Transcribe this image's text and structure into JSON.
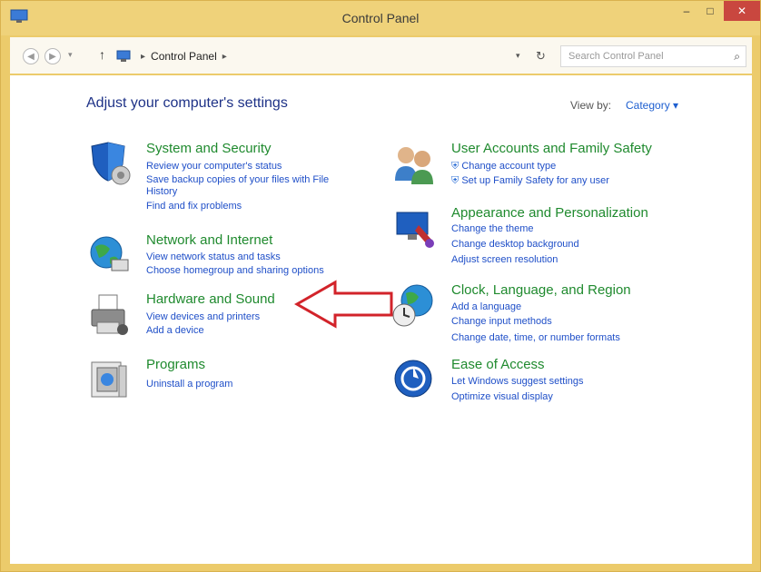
{
  "window": {
    "title": "Control Panel",
    "minimize": "–",
    "maximize": "□",
    "close": "✕"
  },
  "nav": {
    "back_icon": "back-arrow-icon",
    "forward_icon": "forward-arrow-icon",
    "up_icon": "up-arrow-icon",
    "breadcrumb": "Control Panel",
    "search_placeholder": "Search Control Panel"
  },
  "main": {
    "heading": "Adjust your computer's settings",
    "view_by_label": "View by:",
    "view_by_value": "Category ▾"
  },
  "categories": [
    {
      "title": "System and Security",
      "links": [
        "Review your computer's status",
        "Save backup copies of your files with File",
        "History",
        "Find and fix problems"
      ]
    },
    {
      "title": "Network and Internet",
      "links": [
        "View network status and tasks",
        "Choose homegroup and sharing options"
      ]
    },
    {
      "title": "Hardware and Sound",
      "links": [
        "View devices and printers",
        "Add a device"
      ]
    },
    {
      "title": "Programs",
      "links": [
        "Uninstall a program"
      ]
    },
    {
      "title": "User Accounts and Family Safety",
      "links": [
        "Change account type",
        "Set up Family Safety for any user"
      ]
    },
    {
      "title": "Appearance and Personalization",
      "links": [
        "Change the theme",
        "Change desktop background",
        "Adjust screen resolution"
      ]
    },
    {
      "title": "Clock, Language, and Region",
      "links": [
        "Add a language",
        "Change input methods",
        "Change date, time, or number formats"
      ]
    },
    {
      "title": "Ease of Access",
      "links": [
        "Let Windows suggest settings",
        "Optimize visual display"
      ]
    }
  ],
  "colors": {
    "title_bar": "#efd27a",
    "link": "#1f4fc8",
    "category_title": "#1f8a2e",
    "heading": "#1e3287",
    "arrow": "#d2232a"
  }
}
